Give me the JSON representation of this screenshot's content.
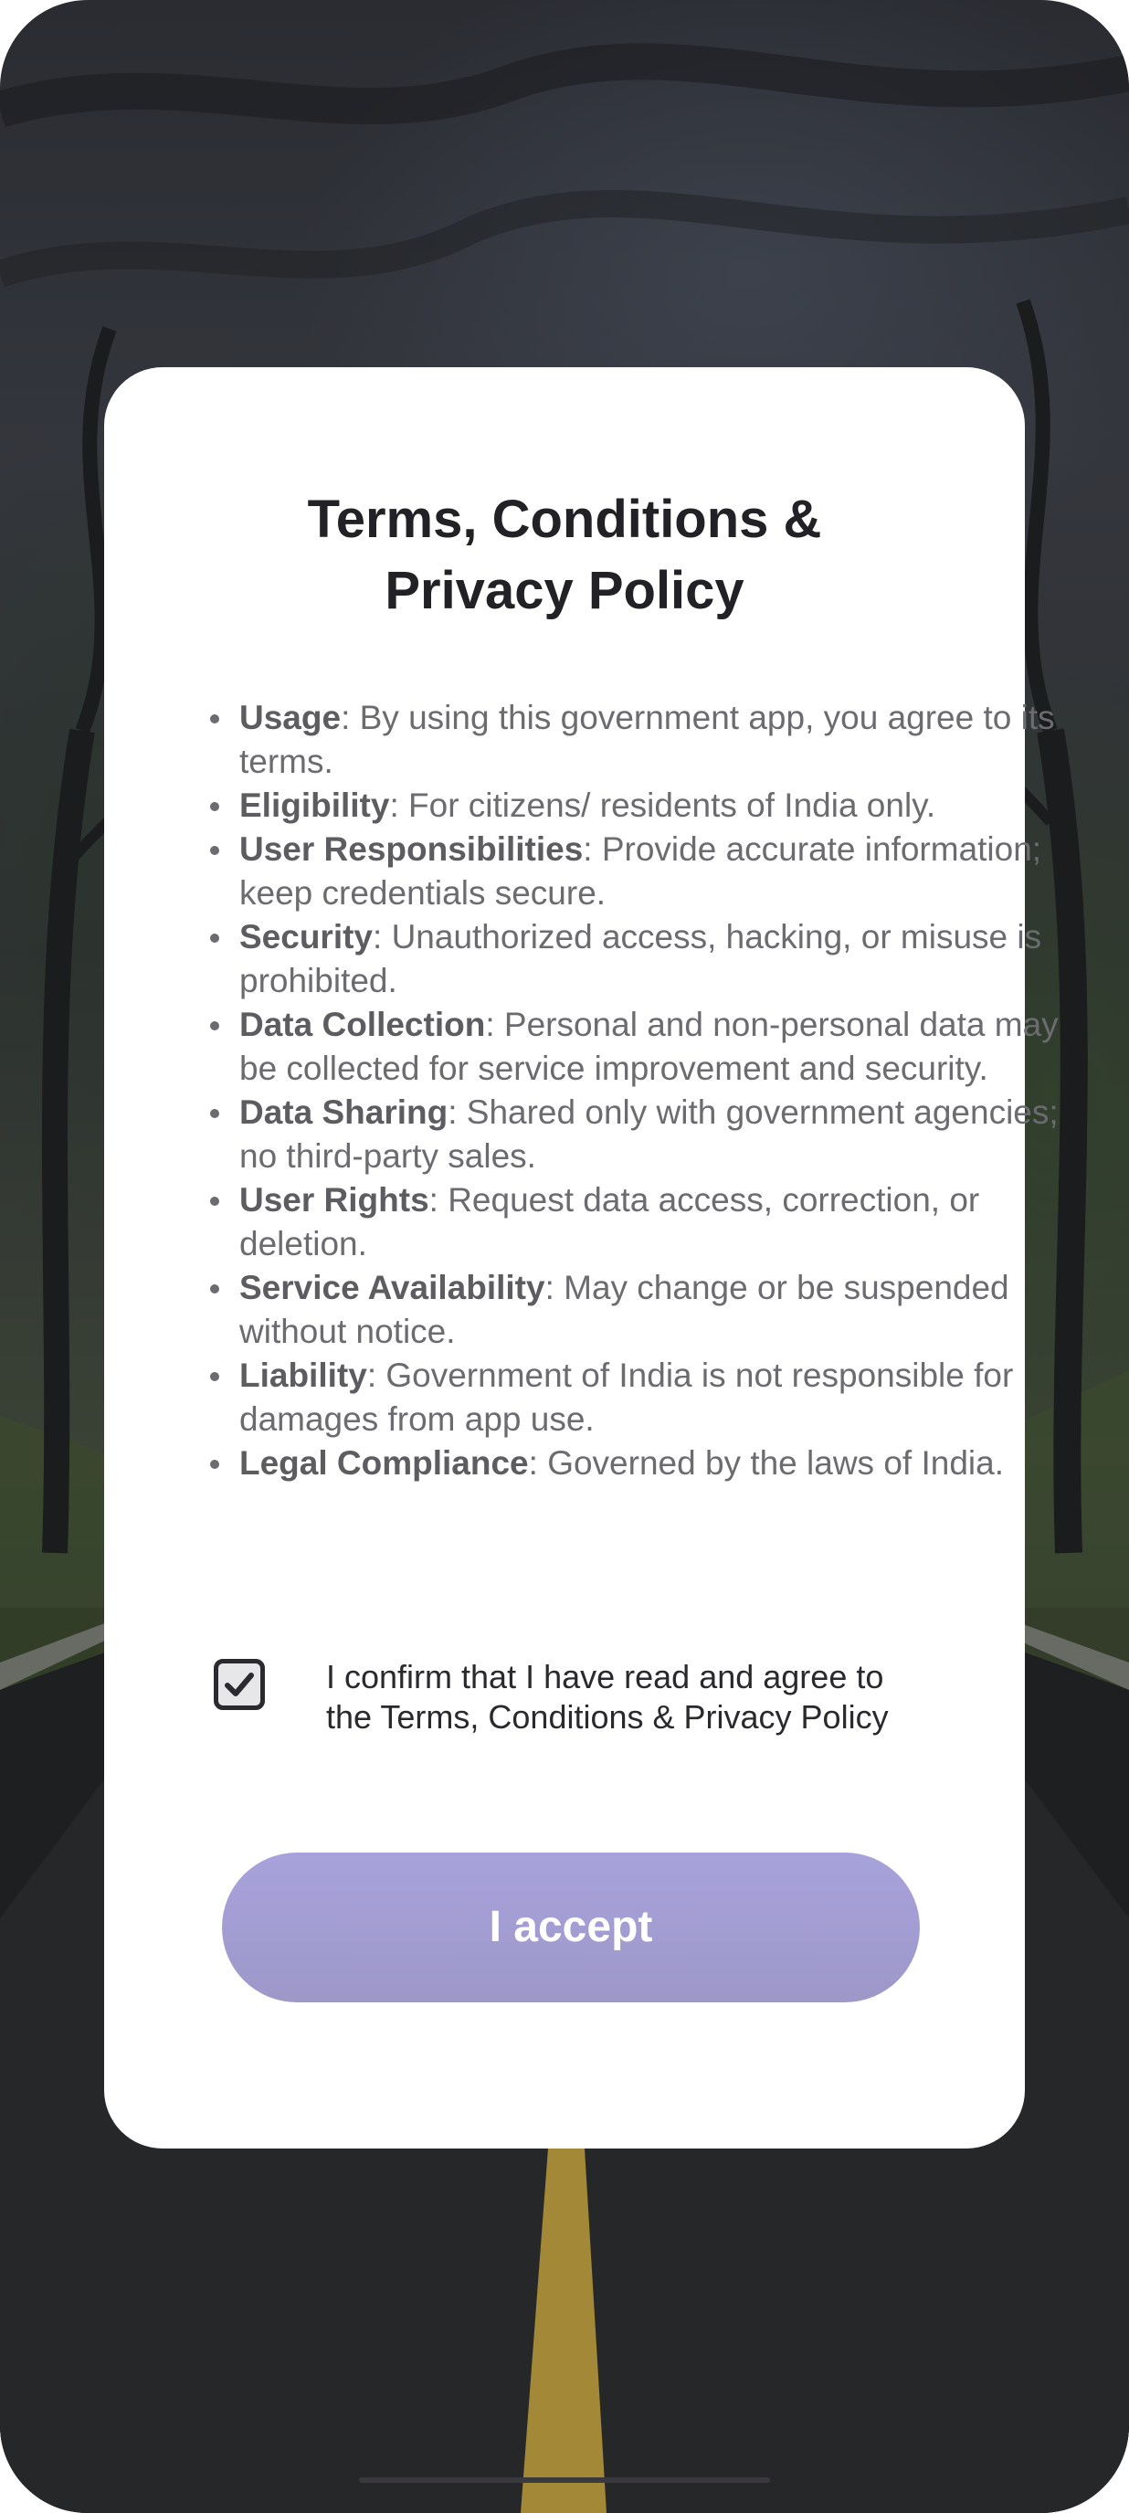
{
  "modal": {
    "title_line1": "Terms, Conditions &",
    "title_line2": "Privacy Policy",
    "terms": [
      {
        "key": "Usage",
        "text": ": By using this government app, you agree to its terms."
      },
      {
        "key": "Eligibility",
        "text": ": For citizens/ residents of India only."
      },
      {
        "key": "User Responsibilities",
        "text": ": Provide accurate information; keep credentials secure."
      },
      {
        "key": "Security",
        "text": ": Unauthorized access, hacking, or misuse is prohibited."
      },
      {
        "key": "Data Collection",
        "text": ": Personal and non-personal data may be collected for service improvement and security."
      },
      {
        "key": "Data Sharing",
        "text": ": Shared only with government agencies; no third-party sales."
      },
      {
        "key": "User Rights",
        "text": ": Request data access, correction, or deletion."
      },
      {
        "key": "Service Availability",
        "text": ": May change or be suspended without notice."
      },
      {
        "key": "Liability",
        "text": ": Government of India is not responsible for damages from app use."
      },
      {
        "key": "Legal Compliance",
        "text": ": Governed by the laws of India."
      }
    ],
    "confirm_checked": true,
    "confirm_line1": "I confirm that I have read and agree to",
    "confirm_line2": "the Terms, Conditions & Privacy Policy",
    "accept_label": "I accept"
  },
  "colors": {
    "card": "#ffffff",
    "button": "#a29ed4",
    "title": "#222226",
    "body_text": "#6b6b70"
  },
  "icons": {
    "checkbox": "check-icon"
  }
}
